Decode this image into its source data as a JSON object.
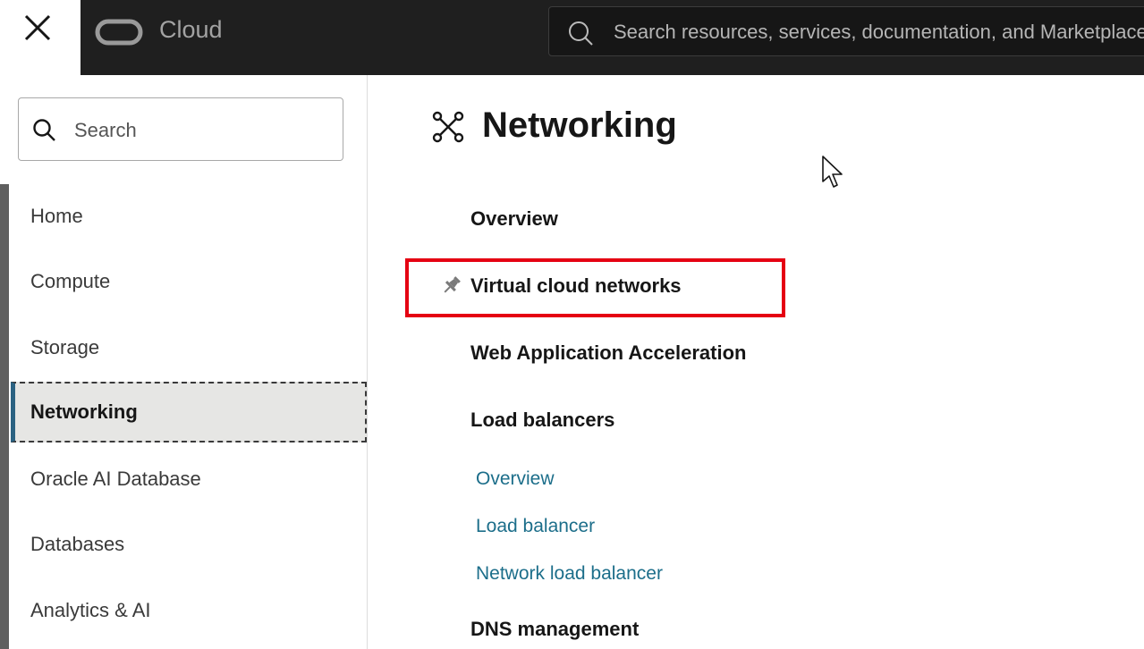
{
  "topbar": {
    "brand": "Cloud",
    "search_placeholder": "Search resources, services, documentation, and Marketplace"
  },
  "leftnav": {
    "search_placeholder": "Search",
    "items": [
      {
        "label": "Home"
      },
      {
        "label": "Compute"
      },
      {
        "label": "Storage"
      },
      {
        "label": "Networking",
        "active": true
      },
      {
        "label": "Oracle AI Database"
      },
      {
        "label": "Databases"
      },
      {
        "label": "Analytics & AI"
      }
    ]
  },
  "main": {
    "title": "Networking",
    "sections": [
      {
        "label": "Overview"
      },
      {
        "label": "Virtual cloud networks",
        "pinned": true,
        "highlighted": true
      },
      {
        "label": "Web Application Acceleration"
      },
      {
        "label": "Load balancers",
        "links": [
          "Overview",
          "Load balancer",
          "Network load balancer"
        ]
      },
      {
        "label": "DNS management"
      }
    ]
  },
  "colors": {
    "topbar_bg": "#1f1f1f",
    "link": "#1c6e8a",
    "active_accent": "#2b6282",
    "highlight": "#e50012"
  },
  "icons": [
    "close-icon",
    "oracle-logo",
    "search-icon",
    "networking-icon",
    "pin-icon",
    "mouse-cursor-icon"
  ]
}
